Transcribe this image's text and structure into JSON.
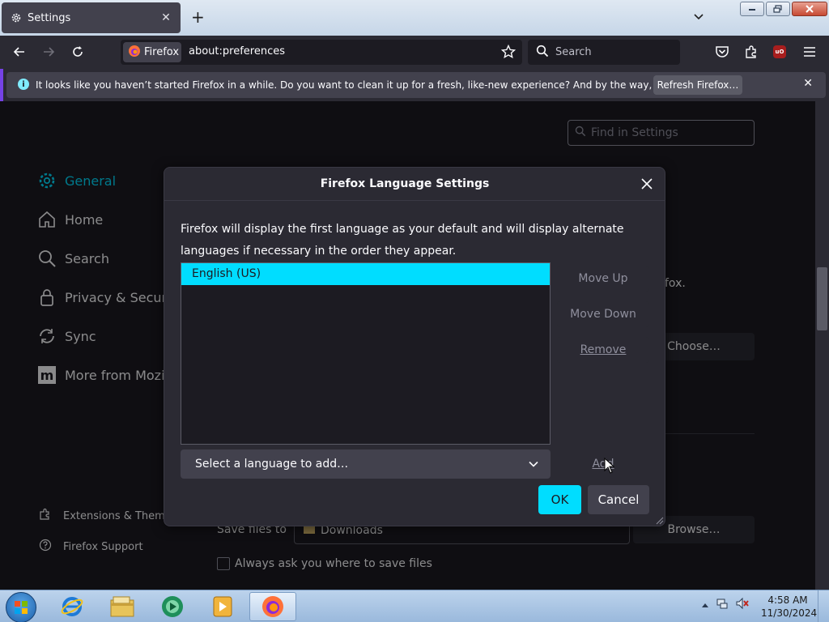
{
  "tab": {
    "title": "Settings"
  },
  "navbar": {
    "identity_label": "Firefox",
    "url": "about:preferences",
    "search_placeholder": "Search",
    "ublock_label": "uO"
  },
  "notification": {
    "text": "It looks like you haven’t started Firefox in a while. Do you want to clean it up for a fresh, like-new experience? And by the way, welcome back!",
    "button_label": "Refresh Firefox…"
  },
  "preferences": {
    "find_placeholder": "Find in Settings",
    "categories": [
      {
        "label": "General",
        "icon": "gear-icon",
        "selected": true
      },
      {
        "label": "Home",
        "icon": "home-icon"
      },
      {
        "label": "Search",
        "icon": "search-icon"
      },
      {
        "label": "Privacy & Security",
        "icon": "lock-icon"
      },
      {
        "label": "Sync",
        "icon": "sync-icon"
      },
      {
        "label": "More from Mozilla",
        "icon": "mozilla-icon"
      }
    ],
    "footer": [
      {
        "label": "Extensions & Themes",
        "icon": "puzzle-icon"
      },
      {
        "label": "Firefox Support",
        "icon": "help-icon"
      }
    ],
    "partial_text": "fox.",
    "choose_button": "Choose…",
    "save_files_label": "Save files to",
    "downloads_value": "Downloads",
    "browse_button": "Browse…",
    "always_ask_label": "Always ask you where to save files"
  },
  "dialog": {
    "title": "Firefox Language Settings",
    "description": "Firefox will display the first language as your default and will display alternate languages if necessary in the order they appear.",
    "languages": [
      "English (US)"
    ],
    "move_up": "Move Up",
    "move_down": "Move Down",
    "remove": "Remove",
    "select_placeholder": "Select a language to add…",
    "add": "Add",
    "ok": "OK",
    "cancel": "Cancel"
  },
  "taskbar": {
    "time": "4:58 AM",
    "date": "11/30/2024",
    "apps": [
      "internet-explorer-icon",
      "file-explorer-icon",
      "media-center-icon",
      "media-player-icon",
      "firefox-icon"
    ]
  },
  "colors": {
    "accent": "#00ddff",
    "background": "#1c1b22",
    "surface": "#2b2a33",
    "notify_stripe": "#7542e5"
  }
}
